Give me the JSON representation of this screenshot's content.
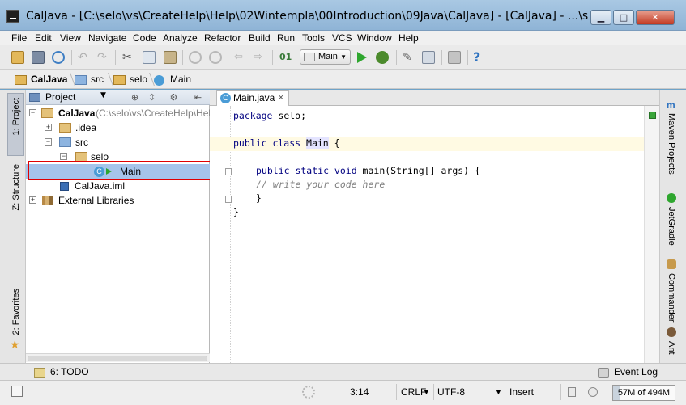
{
  "window": {
    "title": "CalJava - [C:\\selo\\vs\\CreateHelp\\Help\\02Wintempla\\00Introduction\\09Java\\CalJava] - [CalJava] - ...\\s",
    "minimize_glyph": "▁",
    "maximize_glyph": "□",
    "close_glyph": "✕"
  },
  "menu": [
    "File",
    "Edit",
    "View",
    "Navigate",
    "Code",
    "Analyze",
    "Refactor",
    "Build",
    "Run",
    "Tools",
    "VCS",
    "Window",
    "Help"
  ],
  "toolbar": {
    "run_config": "Main",
    "icons": [
      "open-icon",
      "save-icon",
      "sync-icon",
      "undo-icon",
      "redo-icon",
      "cut-icon",
      "copy-icon",
      "paste-icon",
      "find-icon",
      "replace-icon",
      "back-icon",
      "forward-icon",
      "make-icon",
      "run-icon",
      "debug-icon",
      "settings-icon",
      "structure-icon",
      "sdk-icon",
      "help-icon"
    ]
  },
  "breadcrumb": [
    "CalJava",
    "src",
    "selo",
    "Main"
  ],
  "left_stripe": {
    "project": "1: Project",
    "structure": "Z: Structure",
    "favorites": "2: Favorites"
  },
  "project_panel": {
    "view_label": "Project",
    "tree": [
      {
        "label": "CalJava",
        "suffix": " (C:\\selo\\vs\\CreateHelp\\Help"
      },
      {
        "label": ".idea"
      },
      {
        "label": "src"
      },
      {
        "label": "selo"
      },
      {
        "label": "Main"
      },
      {
        "label": "CalJava.iml"
      },
      {
        "label": "External Libraries"
      }
    ]
  },
  "editor": {
    "tab_label": "Main.java",
    "tab_close": "×",
    "lines": [
      {
        "kw": "package",
        "rest": " selo;"
      },
      {
        "kw": "public class",
        "cls": "Main",
        "rest": " {"
      },
      {
        "kw": "public static void",
        "rest": " main(String[] args) {"
      },
      {
        "comment": "// write your code here"
      },
      {
        "rest": "}"
      },
      {
        "rest": "}"
      }
    ]
  },
  "right_stripe": [
    "Maven Projects",
    "JetGradle",
    "Commander",
    "Ant"
  ],
  "bottom_tools": {
    "todo": "6: TODO",
    "event_log": "Event Log"
  },
  "status": {
    "position": "3:14",
    "line_sep": "CRLF",
    "encoding": "UTF-8",
    "mode": "Insert",
    "memory": "57M of 494M"
  },
  "colors": {
    "selection": "#a6c4ea",
    "highlight_border": "#e00000",
    "keyword": "#000080",
    "comment": "#808080",
    "current_line": "#fffae3"
  }
}
